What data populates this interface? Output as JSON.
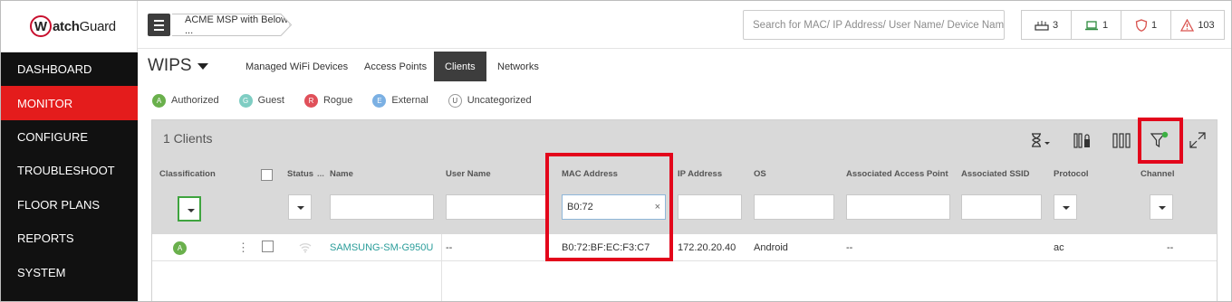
{
  "logo": {
    "brand_bold": "atch",
    "brand_thin": "Guard",
    "badge": "W"
  },
  "sidebar": {
    "items": [
      {
        "label": "DASHBOARD",
        "active": false
      },
      {
        "label": "MONITOR",
        "active": true
      },
      {
        "label": "CONFIGURE",
        "active": false
      },
      {
        "label": "TROUBLESHOOT",
        "active": false
      },
      {
        "label": "FLOOR PLANS",
        "active": false
      },
      {
        "label": "REPORTS",
        "active": false
      },
      {
        "label": "SYSTEM",
        "active": false
      }
    ]
  },
  "topbar": {
    "breadcrumb": "ACME MSP with Below ...",
    "search_placeholder": "Search for MAC/ IP Address/ User Name/ Device Name.",
    "status": [
      {
        "icon": "access-point-icon",
        "count": "3"
      },
      {
        "icon": "laptop-icon",
        "count": "1"
      },
      {
        "icon": "shield-icon",
        "count": "1"
      },
      {
        "icon": "warning-icon",
        "count": "103"
      }
    ]
  },
  "subheader": {
    "title": "WIPS",
    "tabs": [
      {
        "label": "Managed WiFi Devices",
        "active": false
      },
      {
        "label": "Access Points",
        "active": false
      },
      {
        "label": "Clients",
        "active": true
      },
      {
        "label": "Networks",
        "active": false
      }
    ]
  },
  "legend": [
    {
      "letter": "A",
      "label": "Authorized",
      "color": "#6ab04c"
    },
    {
      "letter": "G",
      "label": "Guest",
      "color": "#7fcdc3"
    },
    {
      "letter": "R",
      "label": "Rogue",
      "color": "#e0505a"
    },
    {
      "letter": "E",
      "label": "External",
      "color": "#7bb0e3"
    },
    {
      "letter": "U",
      "label": "Uncategorized",
      "color": "#ffffff"
    }
  ],
  "grid": {
    "count_label": "1 Clients",
    "columns": {
      "classification": "Classification",
      "status": "Status",
      "status_dots": "...",
      "name": "Name",
      "user_name": "User Name",
      "mac": "MAC Address",
      "ip": "IP Address",
      "os": "OS",
      "ap": "Associated Access Point",
      "ssid": "Associated SSID",
      "protocol": "Protocol",
      "channel": "Channel"
    },
    "filters": {
      "mac_value": "B0:72",
      "clear": "×"
    },
    "row": {
      "classification_letter": "A",
      "kebab": "⋮",
      "name": "SAMSUNG-SM-G950U",
      "user_name": "--",
      "mac": "B0:72:BF:EC:F3:C7",
      "ip": "172.20.20.40",
      "os": "Android",
      "ap": "--",
      "ssid": "",
      "protocol": "ac",
      "channel": "--"
    }
  },
  "colors": {
    "accent_red": "#e41c1c",
    "sidebar_bg": "#111111",
    "link": "#2a9d9a",
    "highlight": "#e3051b"
  }
}
